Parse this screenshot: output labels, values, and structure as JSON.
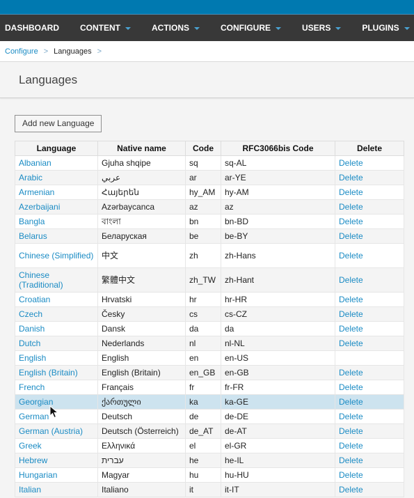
{
  "nav": {
    "items": [
      {
        "label": "Dashboard",
        "dropdown": false
      },
      {
        "label": "Content",
        "dropdown": true
      },
      {
        "label": "Actions",
        "dropdown": true
      },
      {
        "label": "Configure",
        "dropdown": true
      },
      {
        "label": "Users",
        "dropdown": true
      },
      {
        "label": "Plugins",
        "dropdown": true
      }
    ]
  },
  "breadcrumb": {
    "parent": "Configure",
    "current": "Languages",
    "separator": ">"
  },
  "page": {
    "title": "Languages",
    "add_button": "Add new Language"
  },
  "colors": {
    "topbar": "#0079b0",
    "nav_bg": "#383838",
    "link": "#1a8bc4",
    "highlight_row": "#cde3ef"
  },
  "table": {
    "headers": [
      "Language",
      "Native name",
      "Code",
      "RFC3066bis Code",
      "Delete"
    ],
    "rows": [
      {
        "language": "Albanian",
        "native": "Gjuha shqipe",
        "code": "sq",
        "rfc": "sq-AL",
        "delete": "Delete"
      },
      {
        "language": "Arabic",
        "native": "عربي",
        "code": "ar",
        "rfc": "ar-YE",
        "delete": "Delete"
      },
      {
        "language": "Armenian",
        "native": "Հայերեն",
        "code": "hy_AM",
        "rfc": "hy-AM",
        "delete": "Delete"
      },
      {
        "language": "Azerbaijani",
        "native": "Azərbaycanca",
        "code": "az",
        "rfc": "az",
        "delete": "Delete"
      },
      {
        "language": "Bangla",
        "native": "বাংলা",
        "code": "bn",
        "rfc": "bn-BD",
        "delete": "Delete"
      },
      {
        "language": "Belarus",
        "native": "Беларуская",
        "code": "be",
        "rfc": "be-BY",
        "delete": "Delete"
      },
      {
        "language": "Chinese (Simplified)",
        "native": "中文",
        "code": "zh",
        "rfc": "zh-Hans",
        "delete": "Delete"
      },
      {
        "language": "Chinese (Traditional)",
        "native": "繁體中文",
        "code": "zh_TW",
        "rfc": "zh-Hant",
        "delete": "Delete"
      },
      {
        "language": "Croatian",
        "native": "Hrvatski",
        "code": "hr",
        "rfc": "hr-HR",
        "delete": "Delete"
      },
      {
        "language": "Czech",
        "native": "Česky",
        "code": "cs",
        "rfc": "cs-CZ",
        "delete": "Delete"
      },
      {
        "language": "Danish",
        "native": "Dansk",
        "code": "da",
        "rfc": "da",
        "delete": "Delete"
      },
      {
        "language": "Dutch",
        "native": "Nederlands",
        "code": "nl",
        "rfc": "nl-NL",
        "delete": "Delete"
      },
      {
        "language": "English",
        "native": "English",
        "code": "en",
        "rfc": "en-US",
        "delete": ""
      },
      {
        "language": "English (Britain)",
        "native": "English (Britain)",
        "code": "en_GB",
        "rfc": "en-GB",
        "delete": "Delete"
      },
      {
        "language": "French",
        "native": "Français",
        "code": "fr",
        "rfc": "fr-FR",
        "delete": "Delete"
      },
      {
        "language": "Georgian",
        "native": "ქართული",
        "code": "ka",
        "rfc": "ka-GE",
        "delete": "Delete",
        "highlighted": true
      },
      {
        "language": "German",
        "native": "Deutsch",
        "code": "de",
        "rfc": "de-DE",
        "delete": "Delete"
      },
      {
        "language": "German (Austria)",
        "native": "Deutsch (Österreich)",
        "code": "de_AT",
        "rfc": "de-AT",
        "delete": "Delete"
      },
      {
        "language": "Greek",
        "native": "Ελληνικά",
        "code": "el",
        "rfc": "el-GR",
        "delete": "Delete"
      },
      {
        "language": "Hebrew",
        "native": "עברית",
        "code": "he",
        "rfc": "he-IL",
        "delete": "Delete"
      },
      {
        "language": "Hungarian",
        "native": "Magyar",
        "code": "hu",
        "rfc": "hu-HU",
        "delete": "Delete"
      },
      {
        "language": "Italian",
        "native": "Italiano",
        "code": "it",
        "rfc": "it-IT",
        "delete": "Delete"
      }
    ]
  }
}
